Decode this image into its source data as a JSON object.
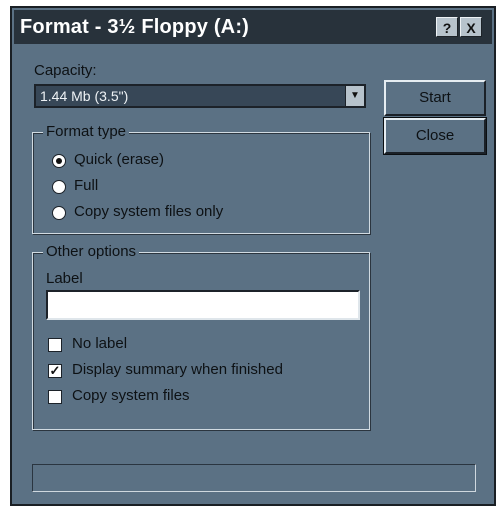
{
  "window": {
    "title": "Format - 3½ Floppy (A:)",
    "help_label": "?",
    "close_label": "X"
  },
  "capacity": {
    "label": "Capacity:",
    "selected": "1.44 Mb (3.5\")"
  },
  "buttons": {
    "start": "Start",
    "close": "Close"
  },
  "format_type": {
    "legend": "Format type",
    "options": [
      {
        "label": "Quick (erase)",
        "selected": true
      },
      {
        "label": "Full",
        "selected": false
      },
      {
        "label": "Copy system files only",
        "selected": false
      }
    ]
  },
  "other_options": {
    "legend": "Other options",
    "label_field": {
      "label": "Label",
      "value": ""
    },
    "checkboxes": [
      {
        "label": "No label",
        "checked": false
      },
      {
        "label": "Display summary when finished",
        "checked": true
      },
      {
        "label": "Copy system files",
        "checked": false
      }
    ]
  },
  "colors": {
    "dialog_bg": "#5b7184",
    "title_bg": "#28323b"
  }
}
